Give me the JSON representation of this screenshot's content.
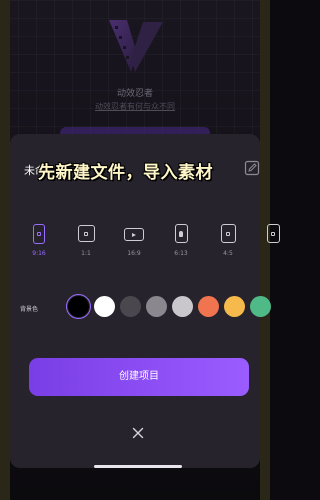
{
  "brand": {
    "name": "动效忍者",
    "subtitle": "动效忍者有何与众不同",
    "logo_icon": "film-strip-v-logo"
  },
  "project": {
    "name_prefix": "未命",
    "caption_overlay": "先新建文件，导入素材",
    "edit_icon": "pencil-icon"
  },
  "aspect_ratios": [
    {
      "label": "9:16",
      "icon": "portrait-icon",
      "selected": true
    },
    {
      "label": "1:1",
      "icon": "square-icon",
      "selected": false
    },
    {
      "label": "16:9",
      "icon": "youtube-play-icon",
      "selected": false
    },
    {
      "label": "6:13",
      "icon": "person-icon",
      "selected": false
    },
    {
      "label": "4:5",
      "icon": "portrait-icon",
      "selected": false
    },
    {
      "label": "",
      "icon": "portrait-icon",
      "selected": false
    }
  ],
  "background": {
    "label": "背景色",
    "colors": [
      "#000000",
      "#ffffff",
      "#4a474f",
      "#8a878f",
      "#c9c7cc",
      "#f0744f",
      "#f6b94b",
      "#4fb987"
    ],
    "selected_index": 0
  },
  "actions": {
    "create_label": "创建项目",
    "close_icon": "close-icon"
  }
}
